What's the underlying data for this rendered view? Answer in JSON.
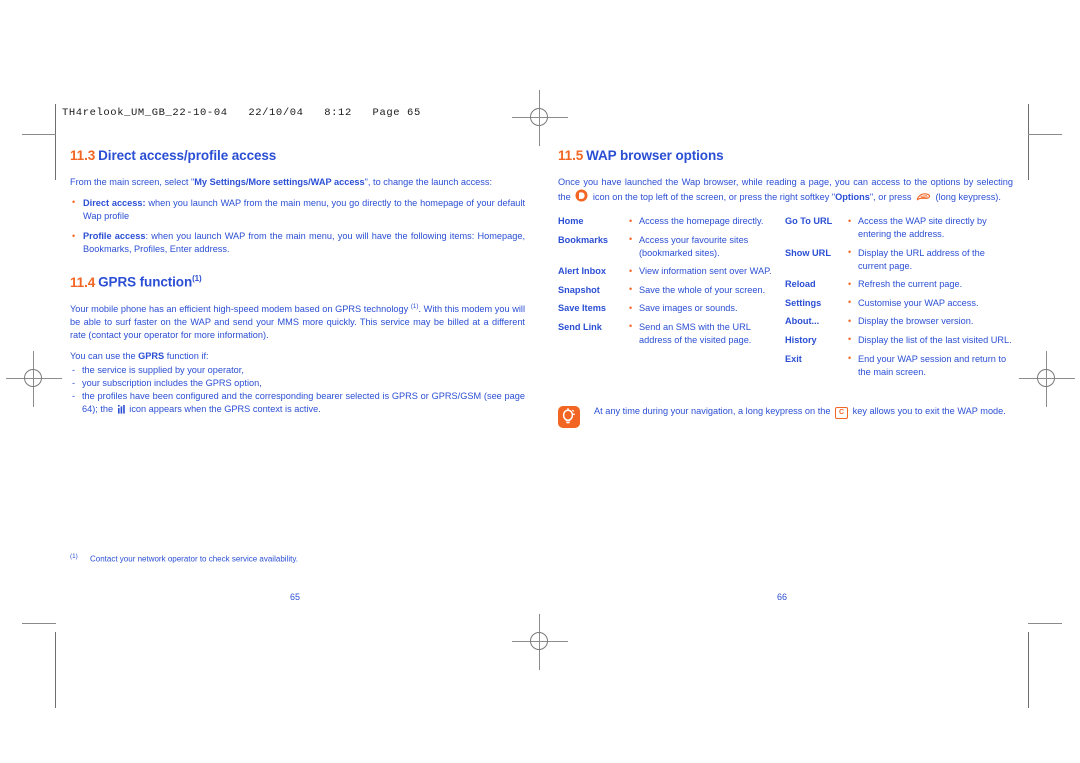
{
  "document": {
    "slug": "TH4relook_UM_GB_22-10-04   22/10/04   8:12   Page 65",
    "colors": {
      "heading_number": "#F26522",
      "heading_text": "#2B4FD4",
      "body_text": "#2B4FD4",
      "bullet": "#F26522",
      "accent_orange": "#F26522"
    },
    "folio_left": "65",
    "folio_right": "66"
  },
  "left_column": {
    "section_11_3": {
      "number": "11.3",
      "title": "Direct access/profile access",
      "intro_pre": "From the main screen, select \"",
      "intro_bold": "My Settings/More settings/WAP access",
      "intro_post": "\", to change the launch access:",
      "bullets": [
        {
          "term": "Direct access:",
          "text": " when you launch WAP from the main menu, you go directly to the homepage of your default Wap profile"
        },
        {
          "term": "Profile access",
          "text": ": when you launch WAP from the main menu, you will have the following items: Homepage, Bookmarks, Profiles, Enter address."
        }
      ]
    },
    "section_11_4": {
      "number": "11.4",
      "title": "GPRS function",
      "title_sup": "(1)",
      "paragraph_1a": "Your mobile phone has an efficient high-speed modem based on GPRS technology ",
      "paragraph_1_sup": "(1)",
      "paragraph_1b": ". With this modem you will be able to surf faster on the WAP and send your MMS more quickly. This service may be billed at a different rate (contact your operator for more information).",
      "lead_pre": "You can use the ",
      "lead_bold": "GPRS",
      "lead_post": " function if:",
      "dashes": [
        "the service is supplied by your operator,",
        "your subscription includes the GPRS option,"
      ],
      "dash_last_a": "the profiles have been configured and the corresponding bearer selected is GPRS or GPRS/GSM (see page 64); the ",
      "dash_last_icon": "gprs-icon",
      "dash_last_b": " icon appears when the GPRS context is active."
    },
    "footnote": {
      "mark": "(1)",
      "text": "Contact your network operator to check service availability."
    }
  },
  "right_column": {
    "section_11_5": {
      "number": "11.5",
      "title": "WAP browser options",
      "intro_a": "Once you have launched the Wap browser, while reading a page, you can access to the options by selecting the ",
      "intro_icon_1": "wap-browser-icon",
      "intro_b": " icon on the top left of the screen, or press the right softkey \"",
      "intro_bold": "Options",
      "intro_c": "\", or press ",
      "intro_icon_2": "key-press-icon",
      "intro_d": " (long keypress)."
    },
    "options_left": [
      {
        "term": "Home",
        "desc": "Access the homepage directly."
      },
      {
        "term": "Bookmarks",
        "desc": "Access your favourite sites (bookmarked sites)."
      },
      {
        "term": "Alert Inbox",
        "desc": "View information sent over WAP."
      },
      {
        "term": "Snapshot",
        "desc": "Save the whole of your screen."
      },
      {
        "term": "Save Items",
        "desc": "Save images or sounds."
      },
      {
        "term": "Send Link",
        "desc": "Send an SMS with the URL address of the visited page."
      }
    ],
    "options_right": [
      {
        "term": "Go To URL",
        "desc": "Access the WAP site directly by entering the address."
      },
      {
        "term": "Show URL",
        "desc": "Display the URL address of the current page."
      },
      {
        "term": "Reload",
        "desc": "Refresh the current page."
      },
      {
        "term": "Settings",
        "desc": "Customise your WAP access."
      },
      {
        "term": "About...",
        "desc": "Display the browser version."
      },
      {
        "term": "History",
        "desc": "Display the list of the last visited URL."
      },
      {
        "term": "Exit",
        "desc": "End your WAP session and return to the main screen."
      }
    ],
    "note": {
      "icon": "tip-bulb-icon",
      "text_a": "At any time during your navigation, a long keypress on the ",
      "key": "C",
      "text_b": " key allows you to exit the WAP mode."
    }
  }
}
